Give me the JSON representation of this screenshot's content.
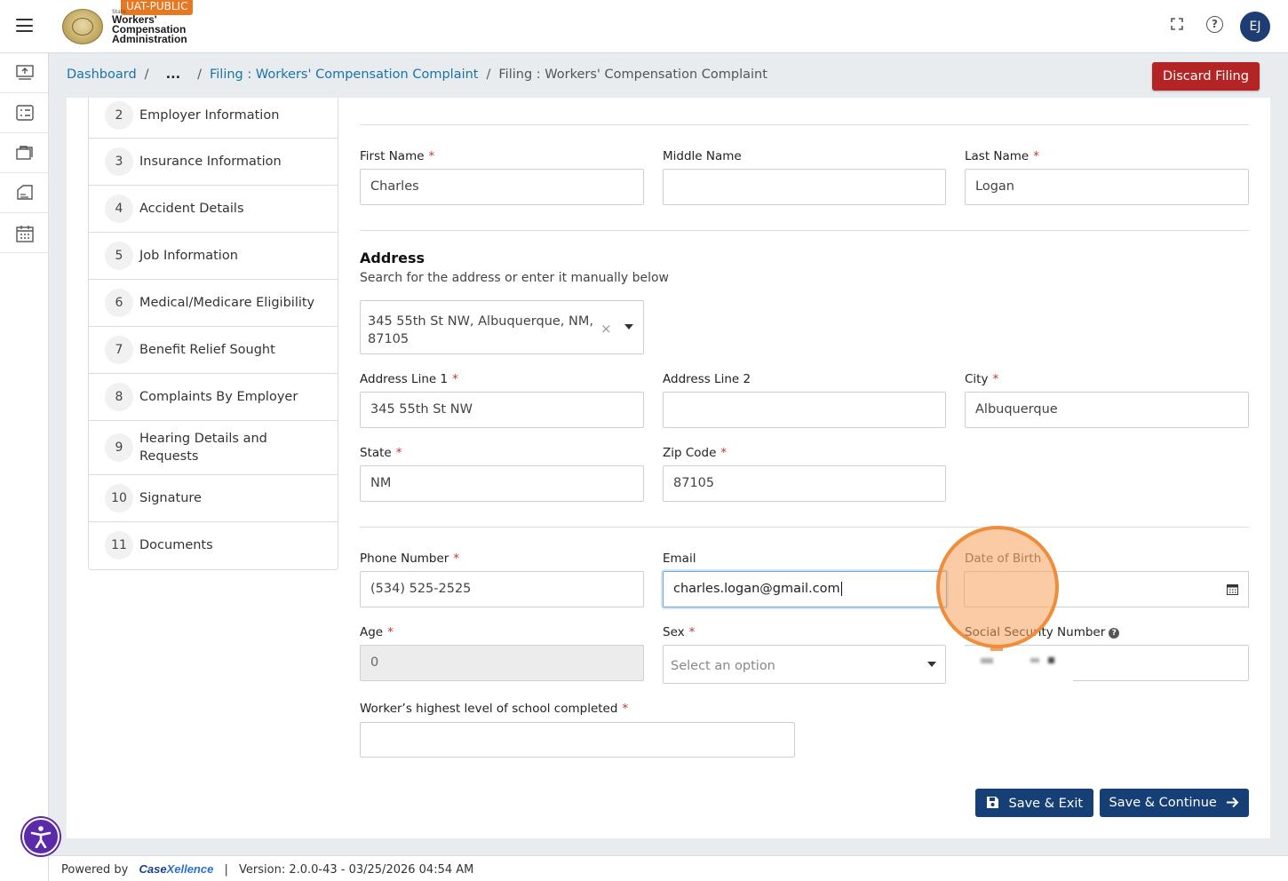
{
  "header": {
    "env_badge": "UAT-PUBLIC",
    "org_small": "State",
    "org_line1": "Workers'",
    "org_line2": "Compensation",
    "org_line3": "Administration",
    "avatar_initials": "EJ",
    "icons": [
      "menu-icon",
      "fullscreen-icon",
      "help-icon"
    ]
  },
  "rail": {
    "icons": [
      "upload-icon",
      "checklist-icon",
      "briefcase-icon",
      "document-icon",
      "calendar-icon"
    ]
  },
  "breadcrumb": {
    "items": [
      "Dashboard",
      "...",
      "Filing : Workers' Compensation Complaint",
      "Filing : Workers' Compensation Complaint"
    ],
    "separator": "/"
  },
  "discard_label": "Discard Filing",
  "steps": [
    {
      "num": "2",
      "label": "Employer Information"
    },
    {
      "num": "3",
      "label": "Insurance Information"
    },
    {
      "num": "4",
      "label": "Accident Details"
    },
    {
      "num": "5",
      "label": "Job Information"
    },
    {
      "num": "6",
      "label": "Medical/Medicare Eligibility"
    },
    {
      "num": "7",
      "label": "Benefit Relief Sought"
    },
    {
      "num": "8",
      "label": "Complaints By Employer"
    },
    {
      "num": "9",
      "label": "Hearing Details and Requests"
    },
    {
      "num": "10",
      "label": "Signature"
    },
    {
      "num": "11",
      "label": "Documents"
    }
  ],
  "form": {
    "required_mark": "*",
    "first_name": {
      "label": "First Name",
      "value": "Charles"
    },
    "middle_name": {
      "label": "Middle Name",
      "value": ""
    },
    "last_name": {
      "label": "Last Name",
      "value": "Logan"
    },
    "address_title": "Address",
    "address_subtitle": "Search for the address or enter it manually below",
    "address_search_value": "345 55th St NW, Albuquerque, NM, 87105",
    "address_line1": {
      "label": "Address Line 1",
      "value": "345 55th St NW"
    },
    "address_line2": {
      "label": "Address Line 2",
      "value": ""
    },
    "city": {
      "label": "City",
      "value": "Albuquerque"
    },
    "state": {
      "label": "State",
      "value": "NM"
    },
    "zip": {
      "label": "Zip Code",
      "value": "87105"
    },
    "phone": {
      "label": "Phone Number",
      "value": "(534) 525-2525"
    },
    "email": {
      "label": "Email",
      "value": "charles.logan@gmail.com"
    },
    "dob": {
      "label": "Date of Birth",
      "value": ""
    },
    "age": {
      "label": "Age",
      "value": "0"
    },
    "sex": {
      "label": "Sex",
      "placeholder": "Select an option"
    },
    "ssn": {
      "label": "Social Security Number"
    },
    "school": {
      "label": "Worker’s highest level of school completed",
      "value": ""
    }
  },
  "buttons": {
    "save_exit": "Save & Exit",
    "save_continue": "Save & Continue"
  },
  "footer": {
    "powered_by": "Powered by",
    "brand_prefix": "Case",
    "brand_suffix": "Xellence",
    "separator": "|",
    "version": "Version: 2.0.0-43 - 03/25/2026 04:54 AM"
  },
  "colors": {
    "primary": "#163f75",
    "danger": "#b52424",
    "link": "#1a73a8",
    "highlight": "#ee8d3b",
    "env_badge": "#e87722"
  }
}
